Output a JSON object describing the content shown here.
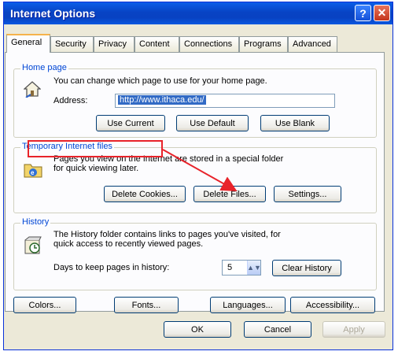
{
  "window": {
    "title": "Internet Options"
  },
  "tabs": [
    {
      "label": "General",
      "active": true
    },
    {
      "label": "Security"
    },
    {
      "label": "Privacy"
    },
    {
      "label": "Content"
    },
    {
      "label": "Connections"
    },
    {
      "label": "Programs"
    },
    {
      "label": "Advanced"
    }
  ],
  "home_page": {
    "legend": "Home page",
    "description": "You can change which page to use for your home page.",
    "address_label": "Address:",
    "address_value": "http://www.ithaca.edu/",
    "buttons": {
      "use_current": "Use Current",
      "use_default": "Use Default",
      "use_blank": "Use Blank"
    }
  },
  "temp_files": {
    "legend": "Temporary Internet files",
    "description_line1": "Pages you view on the Internet are stored in a special folder",
    "description_line2": "for quick viewing later.",
    "buttons": {
      "delete_cookies": "Delete Cookies...",
      "delete_files": "Delete Files...",
      "settings": "Settings..."
    }
  },
  "history": {
    "legend": "History",
    "description_line1": "The History folder contains links to pages you've visited, for",
    "description_line2": "quick access to recently viewed pages.",
    "days_label": "Days to keep pages in history:",
    "days_value": "5",
    "clear_button": "Clear History"
  },
  "bottom_buttons": {
    "colors": "Colors...",
    "fonts": "Fonts...",
    "languages": "Languages...",
    "accessibility": "Accessibility..."
  },
  "dialog_buttons": {
    "ok": "OK",
    "cancel": "Cancel",
    "apply": "Apply"
  },
  "colors": {
    "highlight": "#e8232a",
    "titlebar": "#0a4fd8"
  }
}
